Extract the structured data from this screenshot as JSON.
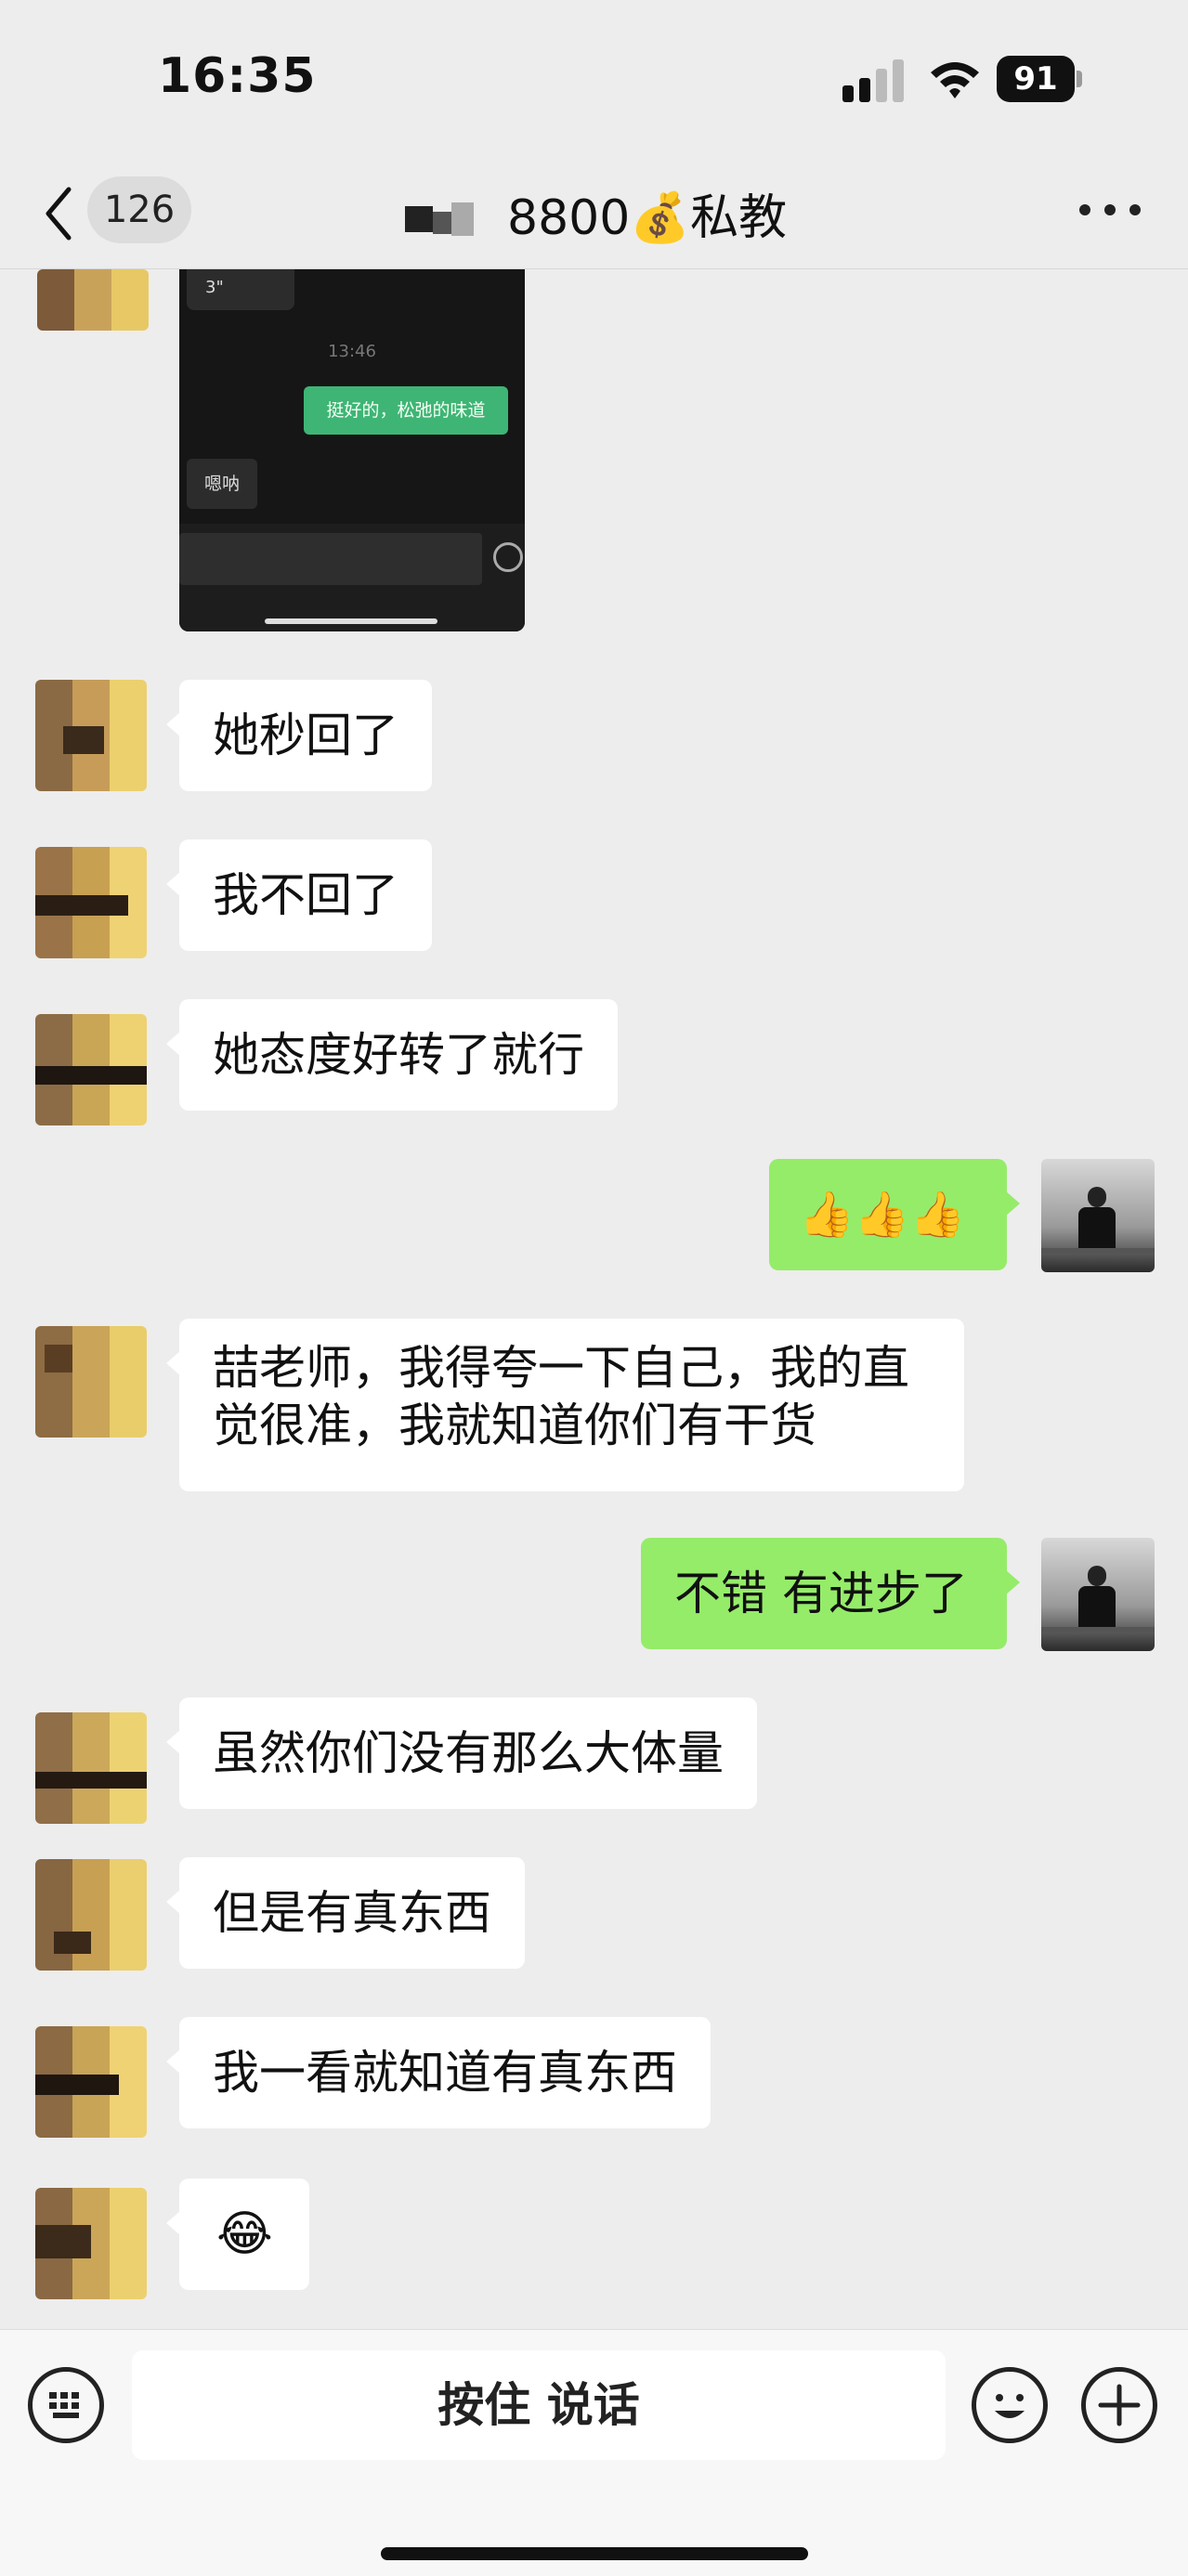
{
  "status_bar": {
    "time": "16:35",
    "battery": "91"
  },
  "nav": {
    "unread_count": "126",
    "title": "8800💰私教"
  },
  "screenshot": {
    "voice_duration": "3\"",
    "timestamp": "13:46",
    "green_message": "挺好的，松弛的味道",
    "gray_message": "嗯呐"
  },
  "messages": [
    {
      "side": "in",
      "text": "她秒回了"
    },
    {
      "side": "in",
      "text": "我不回了"
    },
    {
      "side": "in",
      "text": "她态度好转了就行"
    },
    {
      "side": "out",
      "text": "👍👍👍"
    },
    {
      "side": "in",
      "text": "喆老师，我得夸一下自己，我的直觉很准，我就知道你们有干货"
    },
    {
      "side": "out",
      "text": "不错 有进步了"
    },
    {
      "side": "in",
      "text": "虽然你们没有那么大体量"
    },
    {
      "side": "in",
      "text": "但是有真东西"
    },
    {
      "side": "in",
      "text": "我一看就知道有真东西"
    },
    {
      "side": "in",
      "text": "😂"
    }
  ],
  "input_bar": {
    "hold_to_talk": "按住 说话"
  },
  "colors": {
    "outgoing_bubble": "#95ec69",
    "incoming_bubble": "#ffffff",
    "background": "#ededed"
  },
  "icons": [
    "back-chevron-icon",
    "keyboard-icon",
    "emoji-icon",
    "plus-icon",
    "more-icon",
    "wifi-icon",
    "signal-icon",
    "battery-icon"
  ]
}
